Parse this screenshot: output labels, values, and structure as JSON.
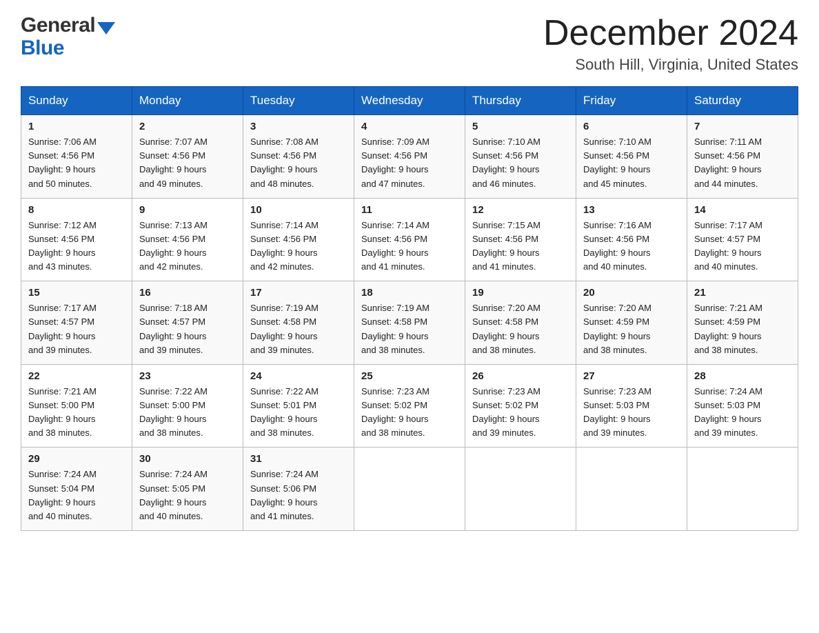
{
  "header": {
    "logo_line1": "General",
    "logo_line2": "Blue",
    "month_year": "December 2024",
    "location": "South Hill, Virginia, United States"
  },
  "days_of_week": [
    "Sunday",
    "Monday",
    "Tuesday",
    "Wednesday",
    "Thursday",
    "Friday",
    "Saturday"
  ],
  "weeks": [
    [
      {
        "day": "1",
        "sunrise": "7:06 AM",
        "sunset": "4:56 PM",
        "daylight": "9 hours and 50 minutes."
      },
      {
        "day": "2",
        "sunrise": "7:07 AM",
        "sunset": "4:56 PM",
        "daylight": "9 hours and 49 minutes."
      },
      {
        "day": "3",
        "sunrise": "7:08 AM",
        "sunset": "4:56 PM",
        "daylight": "9 hours and 48 minutes."
      },
      {
        "day": "4",
        "sunrise": "7:09 AM",
        "sunset": "4:56 PM",
        "daylight": "9 hours and 47 minutes."
      },
      {
        "day": "5",
        "sunrise": "7:10 AM",
        "sunset": "4:56 PM",
        "daylight": "9 hours and 46 minutes."
      },
      {
        "day": "6",
        "sunrise": "7:10 AM",
        "sunset": "4:56 PM",
        "daylight": "9 hours and 45 minutes."
      },
      {
        "day": "7",
        "sunrise": "7:11 AM",
        "sunset": "4:56 PM",
        "daylight": "9 hours and 44 minutes."
      }
    ],
    [
      {
        "day": "8",
        "sunrise": "7:12 AM",
        "sunset": "4:56 PM",
        "daylight": "9 hours and 43 minutes."
      },
      {
        "day": "9",
        "sunrise": "7:13 AM",
        "sunset": "4:56 PM",
        "daylight": "9 hours and 42 minutes."
      },
      {
        "day": "10",
        "sunrise": "7:14 AM",
        "sunset": "4:56 PM",
        "daylight": "9 hours and 42 minutes."
      },
      {
        "day": "11",
        "sunrise": "7:14 AM",
        "sunset": "4:56 PM",
        "daylight": "9 hours and 41 minutes."
      },
      {
        "day": "12",
        "sunrise": "7:15 AM",
        "sunset": "4:56 PM",
        "daylight": "9 hours and 41 minutes."
      },
      {
        "day": "13",
        "sunrise": "7:16 AM",
        "sunset": "4:56 PM",
        "daylight": "9 hours and 40 minutes."
      },
      {
        "day": "14",
        "sunrise": "7:17 AM",
        "sunset": "4:57 PM",
        "daylight": "9 hours and 40 minutes."
      }
    ],
    [
      {
        "day": "15",
        "sunrise": "7:17 AM",
        "sunset": "4:57 PM",
        "daylight": "9 hours and 39 minutes."
      },
      {
        "day": "16",
        "sunrise": "7:18 AM",
        "sunset": "4:57 PM",
        "daylight": "9 hours and 39 minutes."
      },
      {
        "day": "17",
        "sunrise": "7:19 AM",
        "sunset": "4:58 PM",
        "daylight": "9 hours and 39 minutes."
      },
      {
        "day": "18",
        "sunrise": "7:19 AM",
        "sunset": "4:58 PM",
        "daylight": "9 hours and 38 minutes."
      },
      {
        "day": "19",
        "sunrise": "7:20 AM",
        "sunset": "4:58 PM",
        "daylight": "9 hours and 38 minutes."
      },
      {
        "day": "20",
        "sunrise": "7:20 AM",
        "sunset": "4:59 PM",
        "daylight": "9 hours and 38 minutes."
      },
      {
        "day": "21",
        "sunrise": "7:21 AM",
        "sunset": "4:59 PM",
        "daylight": "9 hours and 38 minutes."
      }
    ],
    [
      {
        "day": "22",
        "sunrise": "7:21 AM",
        "sunset": "5:00 PM",
        "daylight": "9 hours and 38 minutes."
      },
      {
        "day": "23",
        "sunrise": "7:22 AM",
        "sunset": "5:00 PM",
        "daylight": "9 hours and 38 minutes."
      },
      {
        "day": "24",
        "sunrise": "7:22 AM",
        "sunset": "5:01 PM",
        "daylight": "9 hours and 38 minutes."
      },
      {
        "day": "25",
        "sunrise": "7:23 AM",
        "sunset": "5:02 PM",
        "daylight": "9 hours and 38 minutes."
      },
      {
        "day": "26",
        "sunrise": "7:23 AM",
        "sunset": "5:02 PM",
        "daylight": "9 hours and 39 minutes."
      },
      {
        "day": "27",
        "sunrise": "7:23 AM",
        "sunset": "5:03 PM",
        "daylight": "9 hours and 39 minutes."
      },
      {
        "day": "28",
        "sunrise": "7:24 AM",
        "sunset": "5:03 PM",
        "daylight": "9 hours and 39 minutes."
      }
    ],
    [
      {
        "day": "29",
        "sunrise": "7:24 AM",
        "sunset": "5:04 PM",
        "daylight": "9 hours and 40 minutes."
      },
      {
        "day": "30",
        "sunrise": "7:24 AM",
        "sunset": "5:05 PM",
        "daylight": "9 hours and 40 minutes."
      },
      {
        "day": "31",
        "sunrise": "7:24 AM",
        "sunset": "5:06 PM",
        "daylight": "9 hours and 41 minutes."
      },
      null,
      null,
      null,
      null
    ]
  ],
  "labels": {
    "sunrise": "Sunrise:",
    "sunset": "Sunset:",
    "daylight": "Daylight:"
  }
}
